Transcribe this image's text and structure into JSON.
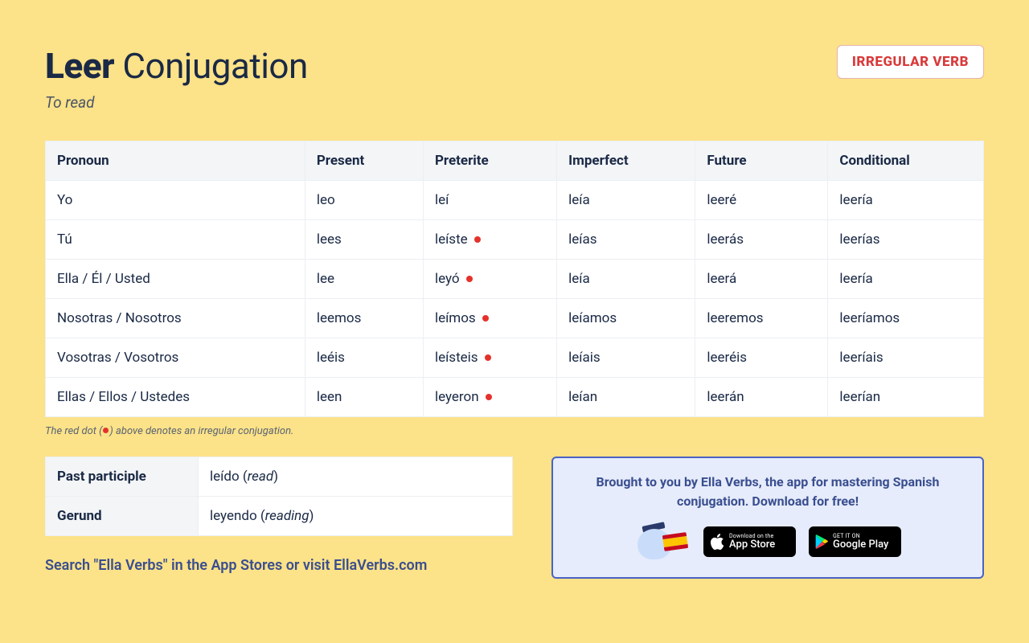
{
  "header": {
    "verb": "Leer",
    "title_suffix": " Conjugation",
    "subtitle": "To read",
    "badge": "IRREGULAR VERB"
  },
  "columns": [
    "Pronoun",
    "Present",
    "Preterite",
    "Imperfect",
    "Future",
    "Conditional"
  ],
  "rows": [
    {
      "pronoun": "Yo",
      "present": {
        "t": "leo",
        "irr": false
      },
      "preterite": {
        "t": "leí",
        "irr": false
      },
      "imperfect": {
        "t": "leía",
        "irr": false
      },
      "future": {
        "t": "leeré",
        "irr": false
      },
      "conditional": {
        "t": "leería",
        "irr": false
      }
    },
    {
      "pronoun": "Tú",
      "present": {
        "t": "lees",
        "irr": false
      },
      "preterite": {
        "t": "leíste",
        "irr": true
      },
      "imperfect": {
        "t": "leías",
        "irr": false
      },
      "future": {
        "t": "leerás",
        "irr": false
      },
      "conditional": {
        "t": "leerías",
        "irr": false
      }
    },
    {
      "pronoun": "Ella / Él / Usted",
      "present": {
        "t": "lee",
        "irr": false
      },
      "preterite": {
        "t": "leyó",
        "irr": true
      },
      "imperfect": {
        "t": "leía",
        "irr": false
      },
      "future": {
        "t": "leerá",
        "irr": false
      },
      "conditional": {
        "t": "leería",
        "irr": false
      }
    },
    {
      "pronoun": "Nosotras / Nosotros",
      "present": {
        "t": "leemos",
        "irr": false
      },
      "preterite": {
        "t": "leímos",
        "irr": true
      },
      "imperfect": {
        "t": "leíamos",
        "irr": false
      },
      "future": {
        "t": "leeremos",
        "irr": false
      },
      "conditional": {
        "t": "leeríamos",
        "irr": false
      }
    },
    {
      "pronoun": "Vosotras / Vosotros",
      "present": {
        "t": "leéis",
        "irr": false
      },
      "preterite": {
        "t": "leísteis",
        "irr": true
      },
      "imperfect": {
        "t": "leíais",
        "irr": false
      },
      "future": {
        "t": "leeréis",
        "irr": false
      },
      "conditional": {
        "t": "leeríais",
        "irr": false
      }
    },
    {
      "pronoun": "Ellas / Ellos / Ustedes",
      "present": {
        "t": "leen",
        "irr": false
      },
      "preterite": {
        "t": "leyeron",
        "irr": true
      },
      "imperfect": {
        "t": "leían",
        "irr": false
      },
      "future": {
        "t": "leerán",
        "irr": false
      },
      "conditional": {
        "t": "leerían",
        "irr": false
      }
    }
  ],
  "footnote": {
    "before": "The red dot (",
    "after": ") above denotes an irregular conjugation."
  },
  "participles": {
    "past_label": "Past participle",
    "past_value": "leído",
    "past_gloss": "read",
    "gerund_label": "Gerund",
    "gerund_value": "leyendo",
    "gerund_gloss": "reading"
  },
  "search_line": {
    "a": "Search \"Ella Verbs\"",
    "b": " in the App Stores or ",
    "c": "visit EllaVerbs.com"
  },
  "promo": {
    "text": "Brought to you by Ella Verbs, the app for mastering Spanish conjugation. Download for free!",
    "appstore_small": "Download on the",
    "appstore_big": "App Store",
    "play_small": "GET IT ON",
    "play_big": "Google Play"
  }
}
